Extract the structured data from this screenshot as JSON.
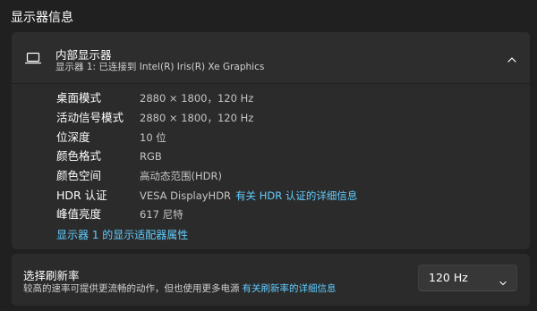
{
  "page": {
    "section_title": "显示器信息"
  },
  "display": {
    "title": "内部显示器",
    "subtitle": "显示器 1: 已连接到 Intel(R) Iris(R) Xe Graphics",
    "icons": {
      "device": "laptop-icon",
      "toggle": "chevron-up-icon"
    },
    "rows": [
      {
        "label": "桌面模式",
        "value": "2880 × 1800，120 Hz"
      },
      {
        "label": "活动信号模式",
        "value": "2880 × 1800，120 Hz"
      },
      {
        "label": "位深度",
        "value": "10 位"
      },
      {
        "label": "颜色格式",
        "value": "RGB"
      },
      {
        "label": "颜色空间",
        "value": "高动态范围(HDR)"
      },
      {
        "label": "HDR 认证",
        "value": "VESA DisplayHDR",
        "link": "有关 HDR 认证的详细信息"
      },
      {
        "label": "峰值亮度",
        "value": "617 尼特"
      }
    ],
    "adapter_link": "显示器 1 的显示适配器属性"
  },
  "refresh_rate": {
    "title": "选择刷新率",
    "description": "较高的速率可提供更流畅的动作，但也使用更多电源",
    "link": "有关刷新率的详细信息",
    "selected": "120 Hz",
    "icons": {
      "dropdown": "chevron-down-icon"
    }
  },
  "colors": {
    "background": "#202020",
    "card": "#2b2b2b",
    "accent_link": "#60cdff",
    "secondary_text": "#c5c5c5"
  }
}
